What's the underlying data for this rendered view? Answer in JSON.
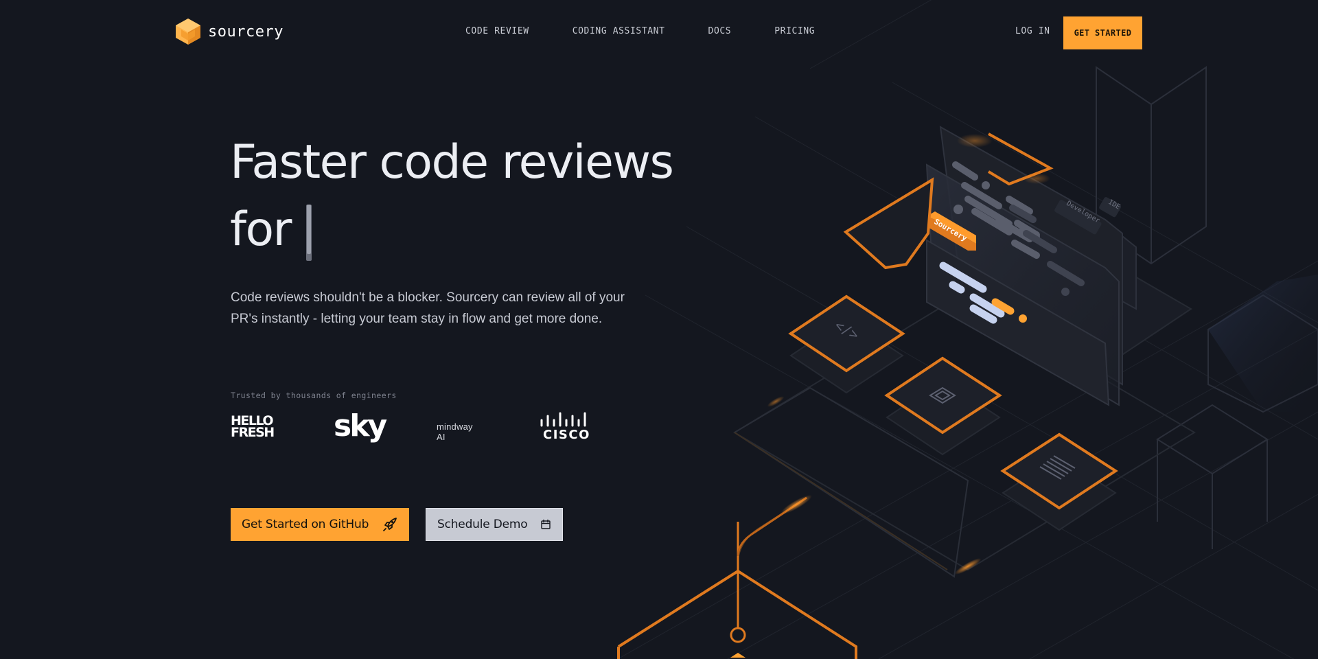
{
  "header": {
    "brand_name": "sourcery",
    "nav": [
      "CODE REVIEW",
      "CODING ASSISTANT",
      "DOCS",
      "PRICING"
    ],
    "login_label": "LOG IN",
    "get_started_label": "GET STARTED"
  },
  "hero": {
    "title_line1": "Faster code reviews",
    "title_line2": "for",
    "subtitle": "Code reviews shouldn't be a blocker. Sourcery can review all of your PR's instantly - letting your team stay in flow and get more done.",
    "trusted_label": "Trusted by thousands of engineers",
    "logos": {
      "hellofresh_1": "HELLO",
      "hellofresh_2": "FRESH",
      "sky": "sky",
      "mindway": "mindway AI",
      "cisco": "CISCO"
    },
    "cta_primary": "Get Started on GitHub",
    "cta_secondary": "Schedule Demo"
  },
  "illustration": {
    "sourcery_tag": "Sourcery",
    "developer_tag": "Developer",
    "ide_tag": "IDE",
    "code_glyph": "</>"
  },
  "colors": {
    "accent": "#ffa332",
    "outline_orange": "#e07a1f",
    "background": "#14171f"
  }
}
